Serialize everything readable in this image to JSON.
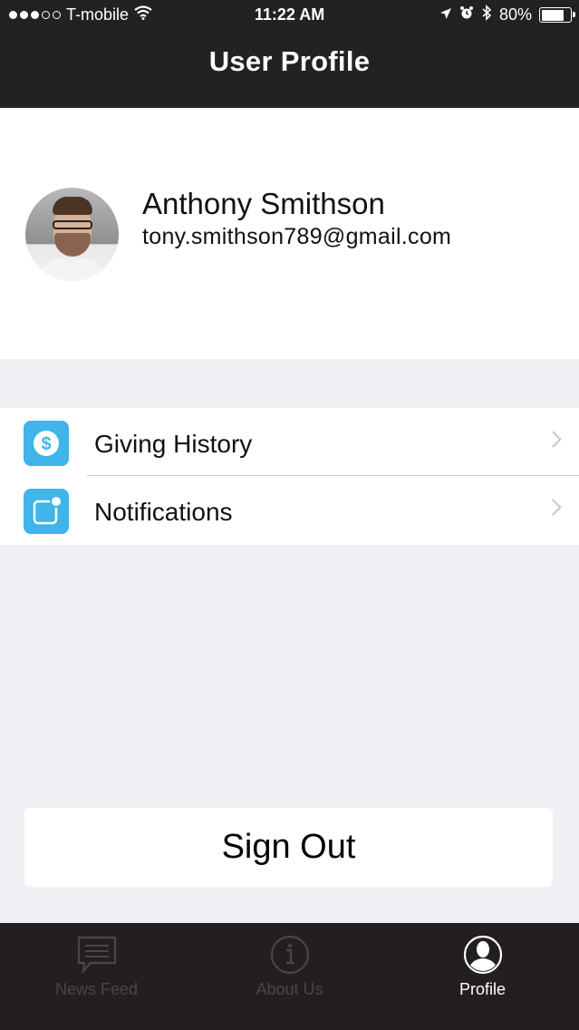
{
  "status_bar": {
    "carrier": "T-mobile",
    "time": "11:22 AM",
    "battery": "80%",
    "battery_level": 0.8,
    "signal_dots_filled": 3,
    "signal_dots_total": 5
  },
  "header": {
    "title": "User Profile"
  },
  "profile": {
    "name": "Anthony Smithson",
    "email": "tony.smithson789@gmail.com"
  },
  "menu": {
    "items": [
      {
        "label": "Giving History",
        "icon": "dollar-circle-icon"
      },
      {
        "label": "Notifications",
        "icon": "notification-badge-icon"
      }
    ]
  },
  "actions": {
    "sign_out": "Sign Out"
  },
  "tabbar": {
    "tabs": [
      {
        "label": "News Feed",
        "icon": "chat-bubble-icon",
        "active": false
      },
      {
        "label": "About Us",
        "icon": "info-circle-icon",
        "active": false
      },
      {
        "label": "Profile",
        "icon": "person-circle-icon",
        "active": true
      }
    ]
  },
  "colors": {
    "header_bg": "#222222",
    "accent_icon": "#3fb5e9",
    "background": "#efeff4",
    "tabbar_bg": "#231f21",
    "tab_inactive": "#4a4648",
    "tab_active": "#ffffff"
  }
}
